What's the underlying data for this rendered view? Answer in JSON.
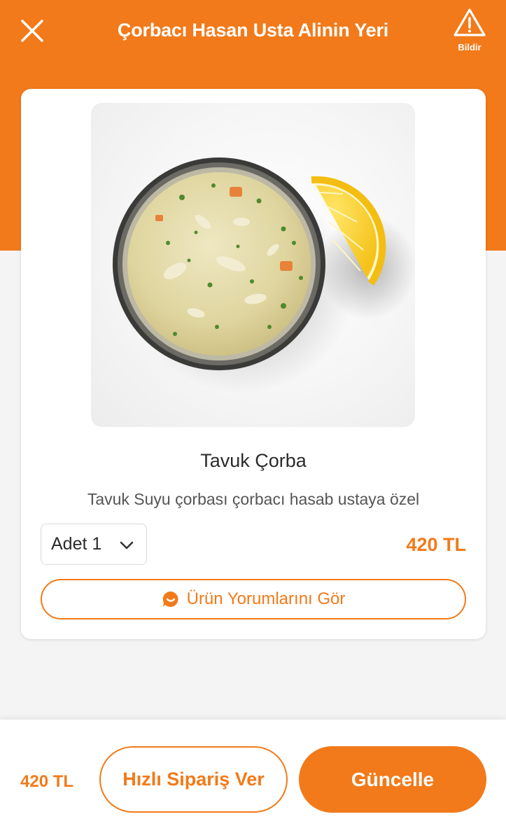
{
  "header": {
    "title": "Çorbacı Hasan Usta Alinin Yeri",
    "close_icon": "close-icon",
    "report_icon": "warning-triangle-icon",
    "report_label": "Bildir"
  },
  "product": {
    "image_icon": "chicken-soup-photo",
    "name": "Tavuk Çorba",
    "description": "Tavuk Suyu çorbası çorbacı hasab ustaya özel",
    "quantity_label": "Adet 1",
    "price": "420 TL",
    "reviews_icon": "chat-bubble-icon",
    "reviews_label": "Ürün Yorumlarını Gör"
  },
  "footer": {
    "total_price": "420 TL",
    "quick_order_label": "Hızlı Sipariş Ver",
    "update_label": "Güncelle"
  },
  "colors": {
    "accent": "#f27a1a",
    "background": "#f4f4f5",
    "card": "#ffffff"
  }
}
